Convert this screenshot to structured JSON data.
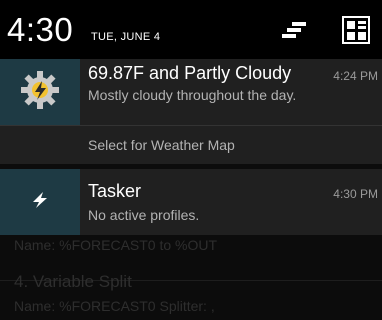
{
  "status_header": {
    "time": "4:30",
    "date": "TUE, JUNE 4",
    "icons": [
      "quick-settings-icon",
      "settings-toggle-icon"
    ]
  },
  "notifications": [
    {
      "app_icon": "tasker-weather-gear-icon",
      "title": "69.87F and Partly Cloudy",
      "subtitle": "Mostly cloudy throughout the day.",
      "time": "4:24 PM",
      "action_label": "Select for Weather Map"
    },
    {
      "app_icon": "tasker-lightning-icon",
      "title": "Tasker",
      "subtitle": "No active profiles.",
      "time": "4:30 PM"
    }
  ],
  "background_app": {
    "line1": "Name: %FORECAST0 to %OUT",
    "line2": "4. Variable Split",
    "line3": "Name: %FORECAST0 Splitter: ,"
  },
  "colors": {
    "shade_background": "#0c0c0c",
    "card_background": "#202020",
    "icon_background": "#1e3a44",
    "accent_yellow": "#f2c230"
  }
}
